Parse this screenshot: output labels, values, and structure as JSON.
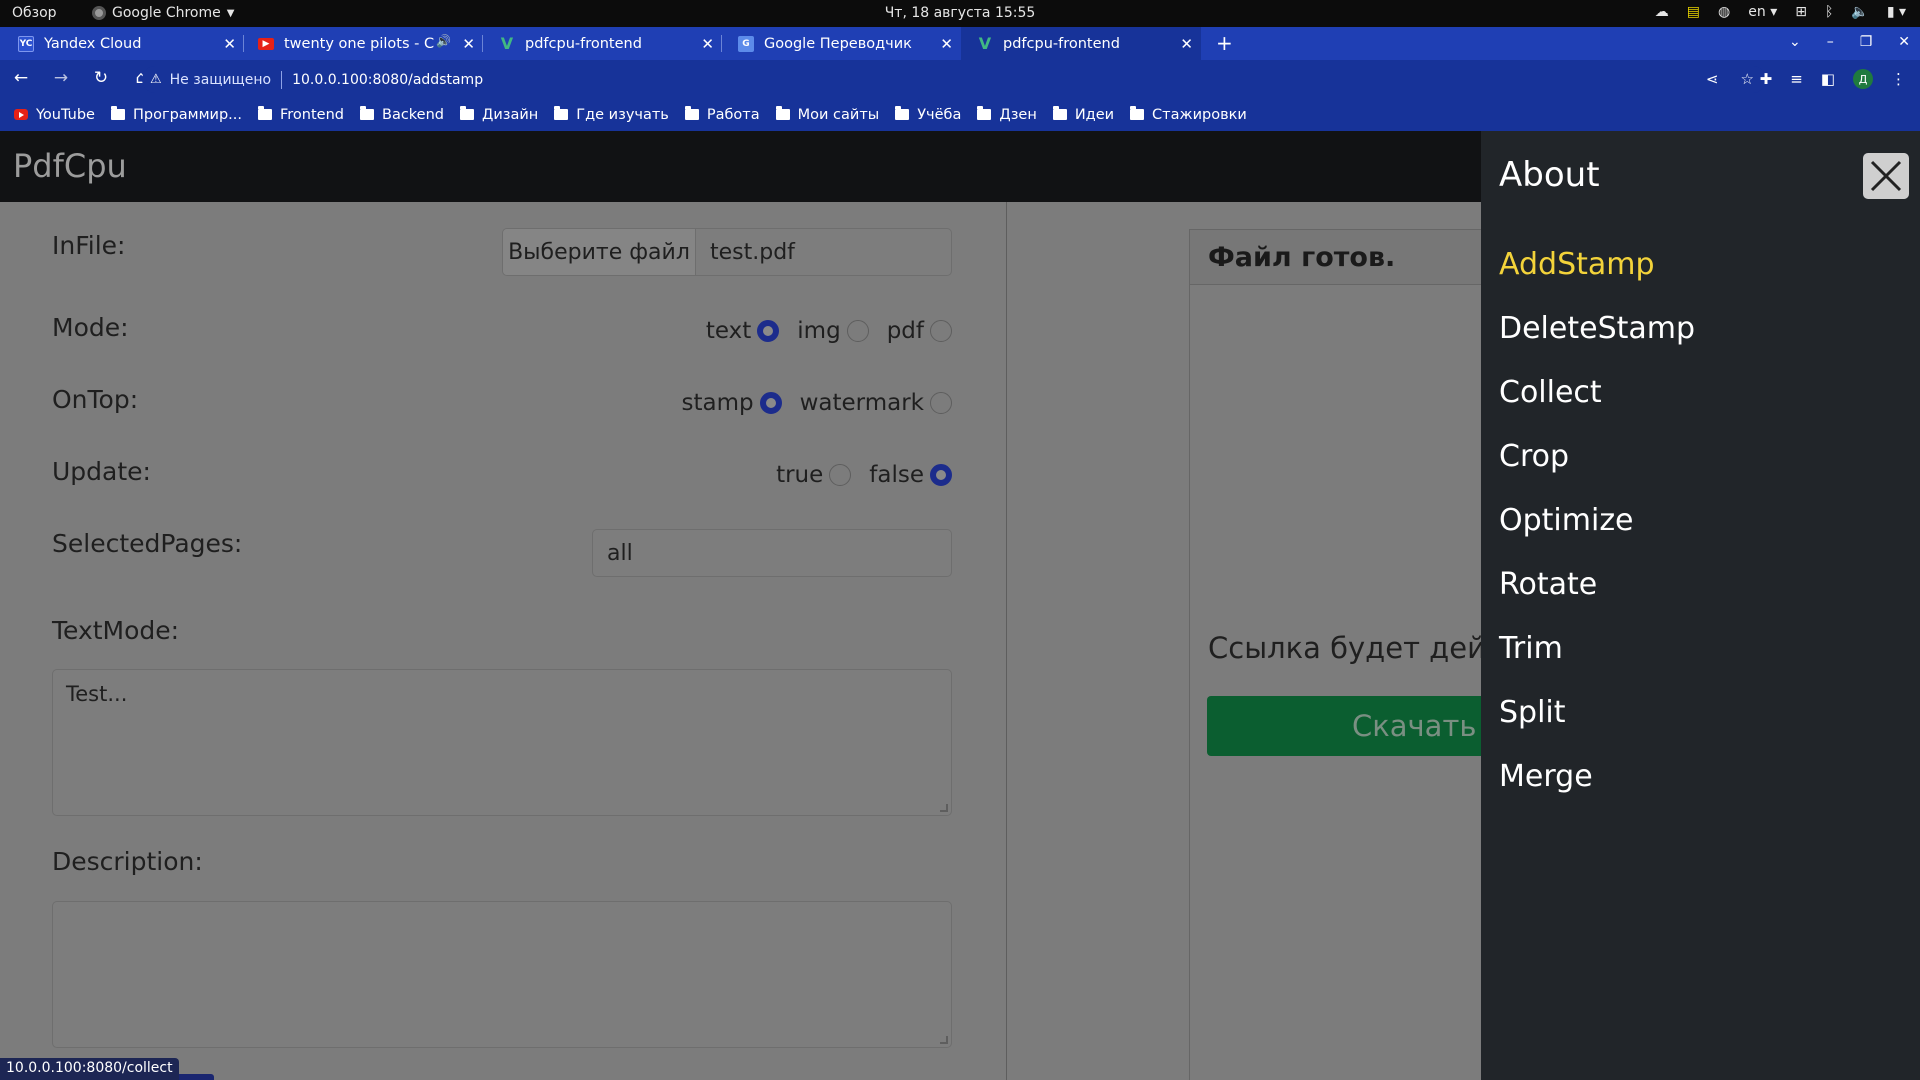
{
  "os": {
    "overview": "Обзор",
    "app_name": "Google Chrome",
    "clock": "Чт, 18 августа  15:55",
    "lang": "en"
  },
  "tabs": [
    {
      "title": "Yandex Cloud",
      "favicon": "yandex-cloud-icon"
    },
    {
      "title": "twenty one pilots - Chl",
      "favicon": "youtube-icon"
    },
    {
      "title": "pdfcpu-frontend",
      "favicon": "vue-icon"
    },
    {
      "title": "Google Переводчик",
      "favicon": "google-translate-icon"
    },
    {
      "title": "pdfcpu-frontend",
      "favicon": "vue-icon",
      "active": true
    }
  ],
  "address": {
    "security": "Не защищено",
    "url": "10.0.0.100:8080/addstamp"
  },
  "bookmarks": [
    "YouTube",
    "Программир...",
    "Frontend",
    "Backend",
    "Дизайн",
    "Где изучать",
    "Работа",
    "Мои сайты",
    "Учёба",
    "Дзен",
    "Идеи",
    "Стажировки"
  ],
  "navbar": {
    "brand": "PdfCpu"
  },
  "form": {
    "infile_label": "InFile:",
    "file_button": "Выберите файл",
    "file_name": "test.pdf",
    "mode_label": "Mode:",
    "mode_options": [
      "text",
      "img",
      "pdf"
    ],
    "mode_selected": "text",
    "ontop_label": "OnTop:",
    "ontop_options": [
      "stamp",
      "watermark"
    ],
    "ontop_selected": "stamp",
    "update_label": "Update:",
    "update_options": [
      "true",
      "false"
    ],
    "update_selected": "false",
    "pages_label": "SelectedPages:",
    "pages_value": "all",
    "textmode_label": "TextMode:",
    "textmode_value": "Test...",
    "description_label": "Description:",
    "description_value": ""
  },
  "result": {
    "card_title": "Файл готов.",
    "link_note": "Ссылка будет дейс",
    "download_button": "Скачать ф"
  },
  "offcanvas": {
    "title": "About",
    "items": [
      "AddStamp",
      "DeleteStamp",
      "Collect",
      "Crop",
      "Optimize",
      "Rotate",
      "Trim",
      "Split",
      "Merge"
    ],
    "active_item": "AddStamp"
  },
  "status_bar": {
    "hover_url": "10.0.0.100:8080/collect"
  },
  "colors": {
    "chrome_blue": "#173399",
    "page_overlay": "#7c7c7c",
    "offcanvas_bg": "#212529",
    "active_link": "#f3d33a",
    "download_green": "#0b5e30",
    "radio_checked": "#1c2c8c"
  }
}
